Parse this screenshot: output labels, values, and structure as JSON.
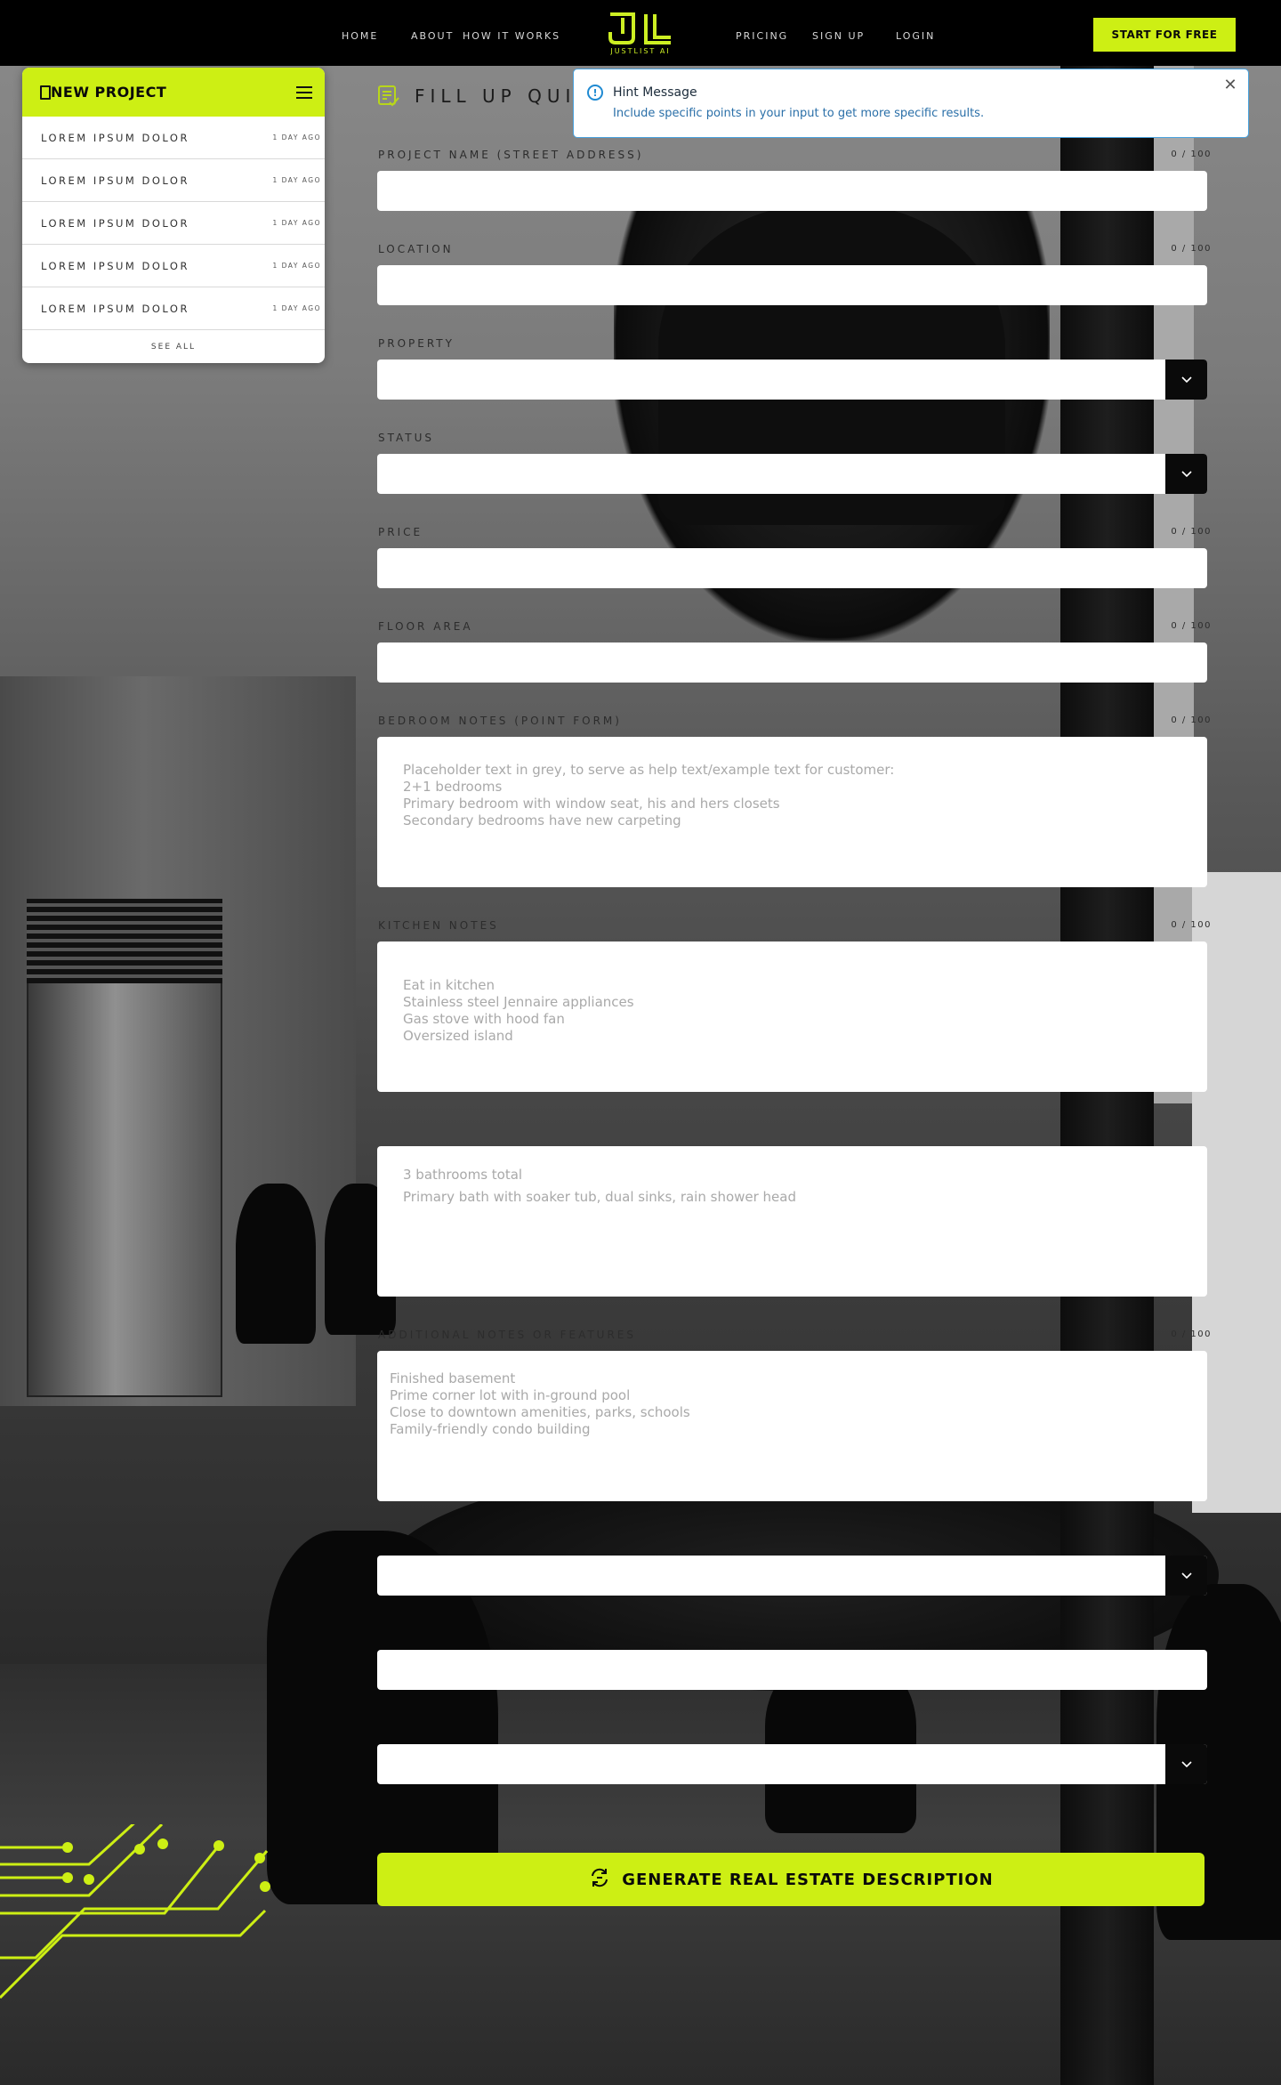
{
  "nav": {
    "links": [
      "HOME",
      "ABOUT",
      "HOW IT WORKS",
      "PRICING",
      "SIGN UP",
      "LOGIN"
    ],
    "logo_text": "JUSTLIST AI",
    "cta_label": "START FOR FREE"
  },
  "sidebar": {
    "title": "NEW PROJECT",
    "items": [
      {
        "name": "LOREM IPSUM DOLOR",
        "time": "1 DAY AGO"
      },
      {
        "name": "LOREM IPSUM DOLOR",
        "time": "1 DAY AGO"
      },
      {
        "name": "LOREM IPSUM DOLOR",
        "time": "1 DAY AGO"
      },
      {
        "name": "LOREM IPSUM DOLOR",
        "time": "1 DAY AGO"
      },
      {
        "name": "LOREM IPSUM DOLOR",
        "time": "1 DAY AGO"
      }
    ],
    "see_all": "SEE ALL"
  },
  "form": {
    "title": "FILL UP QUIC",
    "fields": {
      "project_name": {
        "label": "PROJECT NAME (STREET ADDRESS)",
        "count": "0 / 100"
      },
      "location": {
        "label": "LOCATION",
        "count": "0 / 100"
      },
      "property": {
        "label": "PROPERTY"
      },
      "status": {
        "label": "STATUS"
      },
      "price": {
        "label": "PRICE",
        "count": "0 / 100"
      },
      "floor_area": {
        "label": "FLOOR AREA",
        "count": "0 / 100"
      },
      "bedroom_notes": {
        "label": "BEDROOM NOTES (POINT FORM)",
        "count": "0 / 100",
        "placeholder_lines": [
          "Placeholder text in grey, to serve as help text/example text for customer:",
          "2+1  bedrooms",
          "Primary bedroom with window seat, his and hers closets",
          "Secondary bedrooms  have new carpeting"
        ]
      },
      "kitchen_notes": {
        "label": "KITCHEN NOTES",
        "count": "0 / 100",
        "placeholder_lines": [
          "Eat in kitchen",
          "Stainless steel Jennaire appliances",
          "Gas stove with hood fan",
          "Oversized  island"
        ]
      },
      "bathroom_notes": {
        "placeholder_lines": [
          "3 bathrooms total",
          "Primary bath with soaker tub, dual sinks, rain shower head"
        ]
      },
      "additional_notes": {
        "label": "ADDITIONAL NOTES OR FEATURES",
        "count": "0 / 100",
        "placeholder_lines": [
          "Finished basement",
          "Prime corner lot with in-ground pool",
          "Close to downtown amenities,  parks, schools",
          "Family-friendly condo building"
        ]
      }
    },
    "generate_label": "GENERATE REAL ESTATE DESCRIPTION"
  },
  "hint": {
    "title": "Hint Message",
    "text": "Include specific points in your input to get more specific results."
  },
  "colors": {
    "accent": "#cdef14",
    "nav_bg": "#000000",
    "hint_border": "#4aa3df"
  }
}
